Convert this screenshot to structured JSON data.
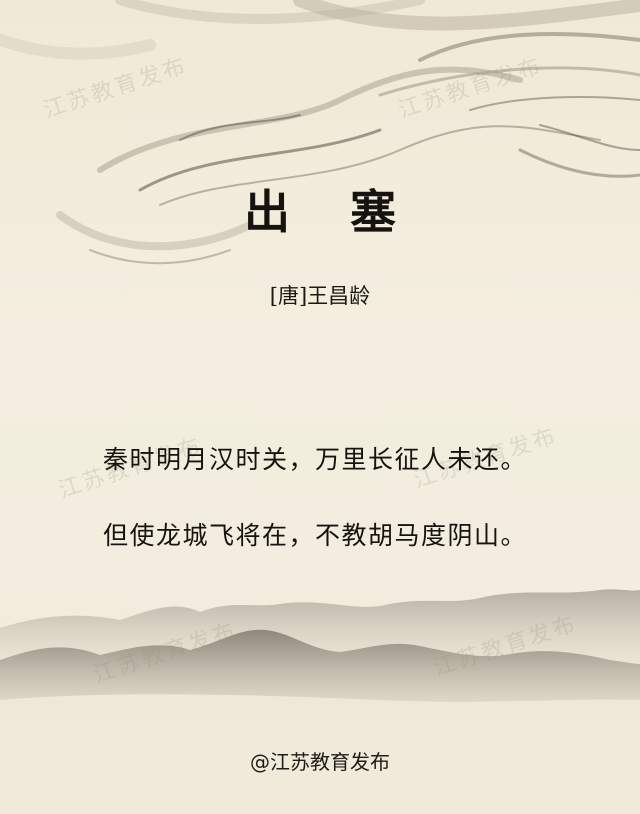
{
  "poem": {
    "title": "出 塞",
    "author": "[唐]王昌龄",
    "lines": [
      "秦时明月汉时关，万里长征人未还。",
      "但使龙城飞将在，不教胡马度阴山。"
    ]
  },
  "watermark_text": "江苏教育发布",
  "credit": "@江苏教育发布",
  "colors": {
    "paper": "#f1ecdc",
    "ink": "#151310",
    "mountain_dark": "#8c877b",
    "mountain_light": "#bdb7a8"
  }
}
